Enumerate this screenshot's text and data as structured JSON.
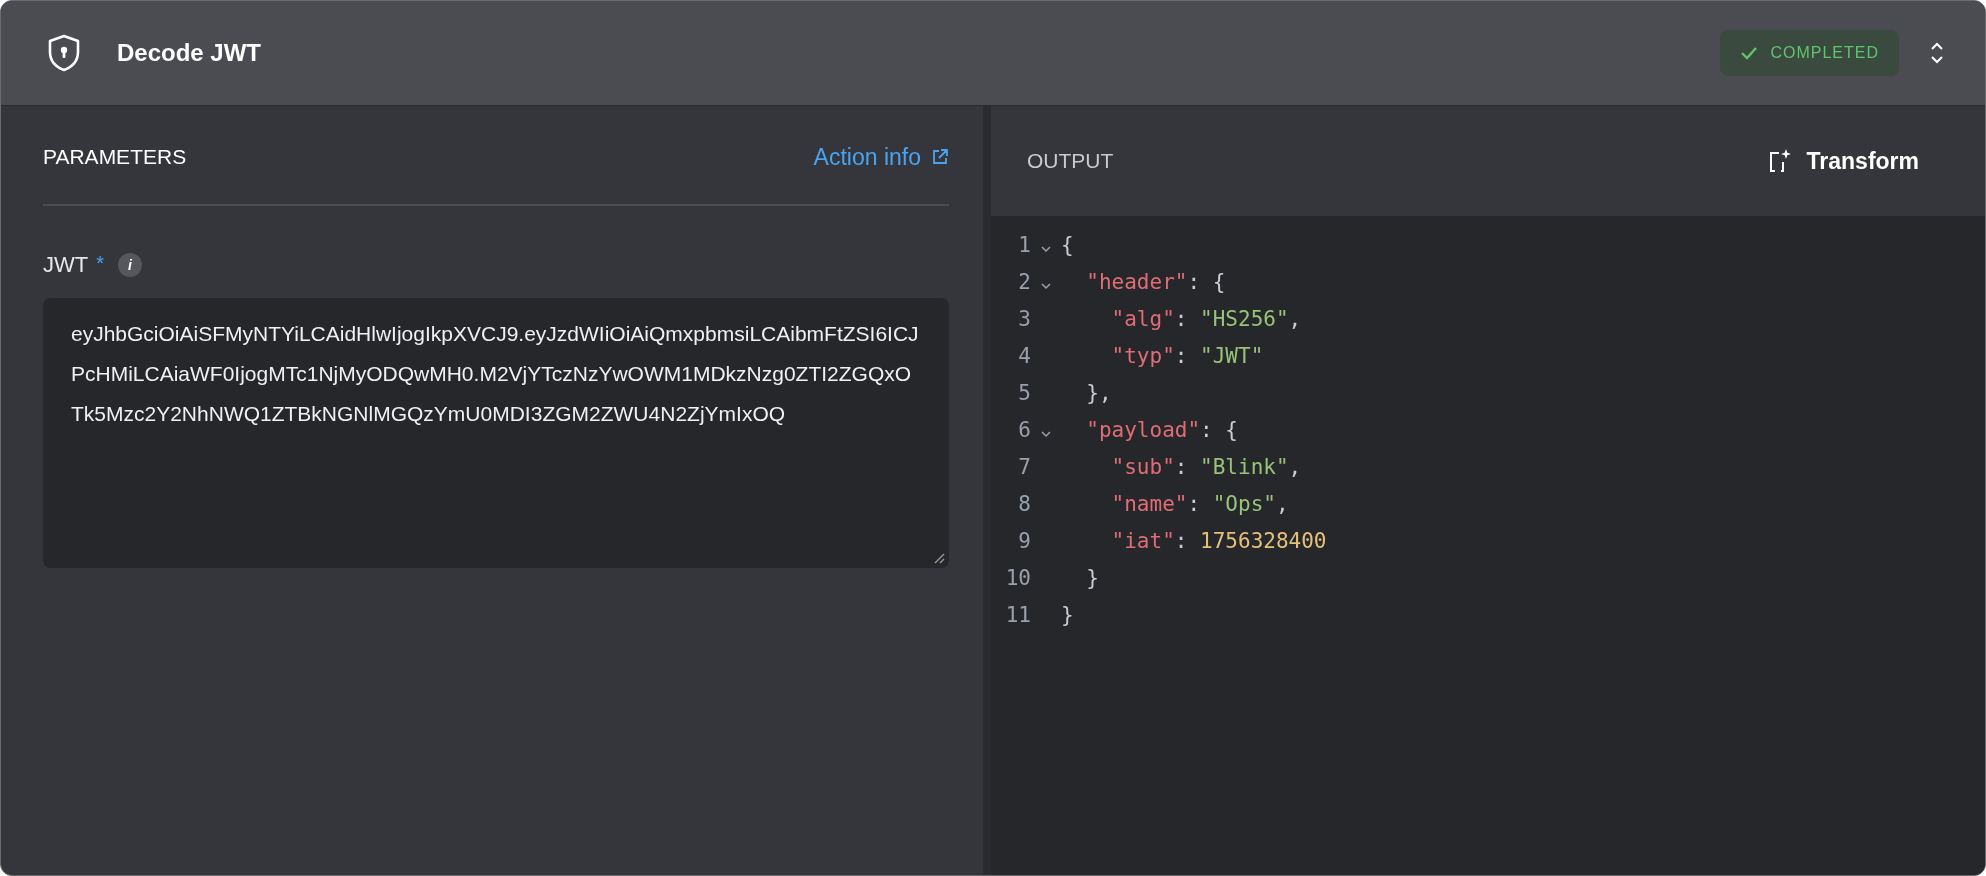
{
  "header": {
    "title": "Decode JWT",
    "status": {
      "label": "COMPLETED",
      "kind": "success"
    },
    "expanded": true
  },
  "parameters": {
    "title": "PARAMETERS",
    "link": "Action info",
    "fields": [
      {
        "label": "JWT",
        "required": true,
        "required_mark": "*",
        "info_mark": "i",
        "value": "eyJhbGciOiAiSFMyNTYiLCAidHlwIjogIkpXVCJ9.eyJzdWIiOiAiQmxpbmsiLCAibmFtZSI6ICJPcHMiLCAiaWF0IjogMTc1NjMyODQwMH0.M2VjYTczNzYwOWM1MDkzNzg0ZTI2ZGQxOTk5Mzc2Y2NhNWQ1ZTBkNGNlMGQzYmU0MDI3ZGM2ZWU4N2ZjYmIxOQ"
      }
    ]
  },
  "output": {
    "title": "OUTPUT",
    "transform_button": "Transform",
    "lines": [
      {
        "number": "1",
        "foldable": true,
        "tokens": [
          {
            "kind": "punct",
            "text": "{"
          }
        ],
        "children": [
          {
            "number": "2",
            "foldable": true,
            "tokens": [
              {
                "kind": "key",
                "text": "\"header\""
              },
              {
                "kind": "punct",
                "text": ": {"
              }
            ],
            "children": [
              {
                "number": "3",
                "foldable": false,
                "tokens": [
                  {
                    "kind": "key",
                    "text": "\"alg\""
                  },
                  {
                    "kind": "punct",
                    "text": ": "
                  },
                  {
                    "kind": "string",
                    "text": "\"HS256\""
                  },
                  {
                    "kind": "punct",
                    "text": ","
                  }
                ]
              },
              {
                "number": "4",
                "foldable": false,
                "tokens": [
                  {
                    "kind": "key",
                    "text": "\"typ\""
                  },
                  {
                    "kind": "punct",
                    "text": ": "
                  },
                  {
                    "kind": "string",
                    "text": "\"JWT\""
                  }
                ]
              }
            ]
          },
          {
            "number": "5",
            "foldable": false,
            "tokens": [
              {
                "kind": "punct",
                "text": "},"
              }
            ]
          },
          {
            "number": "6",
            "foldable": true,
            "tokens": [
              {
                "kind": "key",
                "text": "\"payload\""
              },
              {
                "kind": "punct",
                "text": ": {"
              }
            ],
            "children": [
              {
                "number": "7",
                "foldable": false,
                "tokens": [
                  {
                    "kind": "key",
                    "text": "\"sub\""
                  },
                  {
                    "kind": "punct",
                    "text": ": "
                  },
                  {
                    "kind": "string",
                    "text": "\"Blink\""
                  },
                  {
                    "kind": "punct",
                    "text": ","
                  }
                ]
              },
              {
                "number": "8",
                "foldable": false,
                "tokens": [
                  {
                    "kind": "key",
                    "text": "\"name\""
                  },
                  {
                    "kind": "punct",
                    "text": ": "
                  },
                  {
                    "kind": "string",
                    "text": "\"Ops\""
                  },
                  {
                    "kind": "punct",
                    "text": ","
                  }
                ]
              },
              {
                "number": "9",
                "foldable": false,
                "tokens": [
                  {
                    "kind": "key",
                    "text": "\"iat\""
                  },
                  {
                    "kind": "punct",
                    "text": ": "
                  },
                  {
                    "kind": "number",
                    "text": "1756328400"
                  }
                ]
              }
            ]
          },
          {
            "number": "10",
            "foldable": false,
            "tokens": [
              {
                "kind": "punct",
                "text": "}"
              }
            ]
          }
        ]
      },
      {
        "number": "11",
        "foldable": false,
        "tokens": [
          {
            "kind": "punct",
            "text": "}"
          }
        ]
      }
    ]
  }
}
